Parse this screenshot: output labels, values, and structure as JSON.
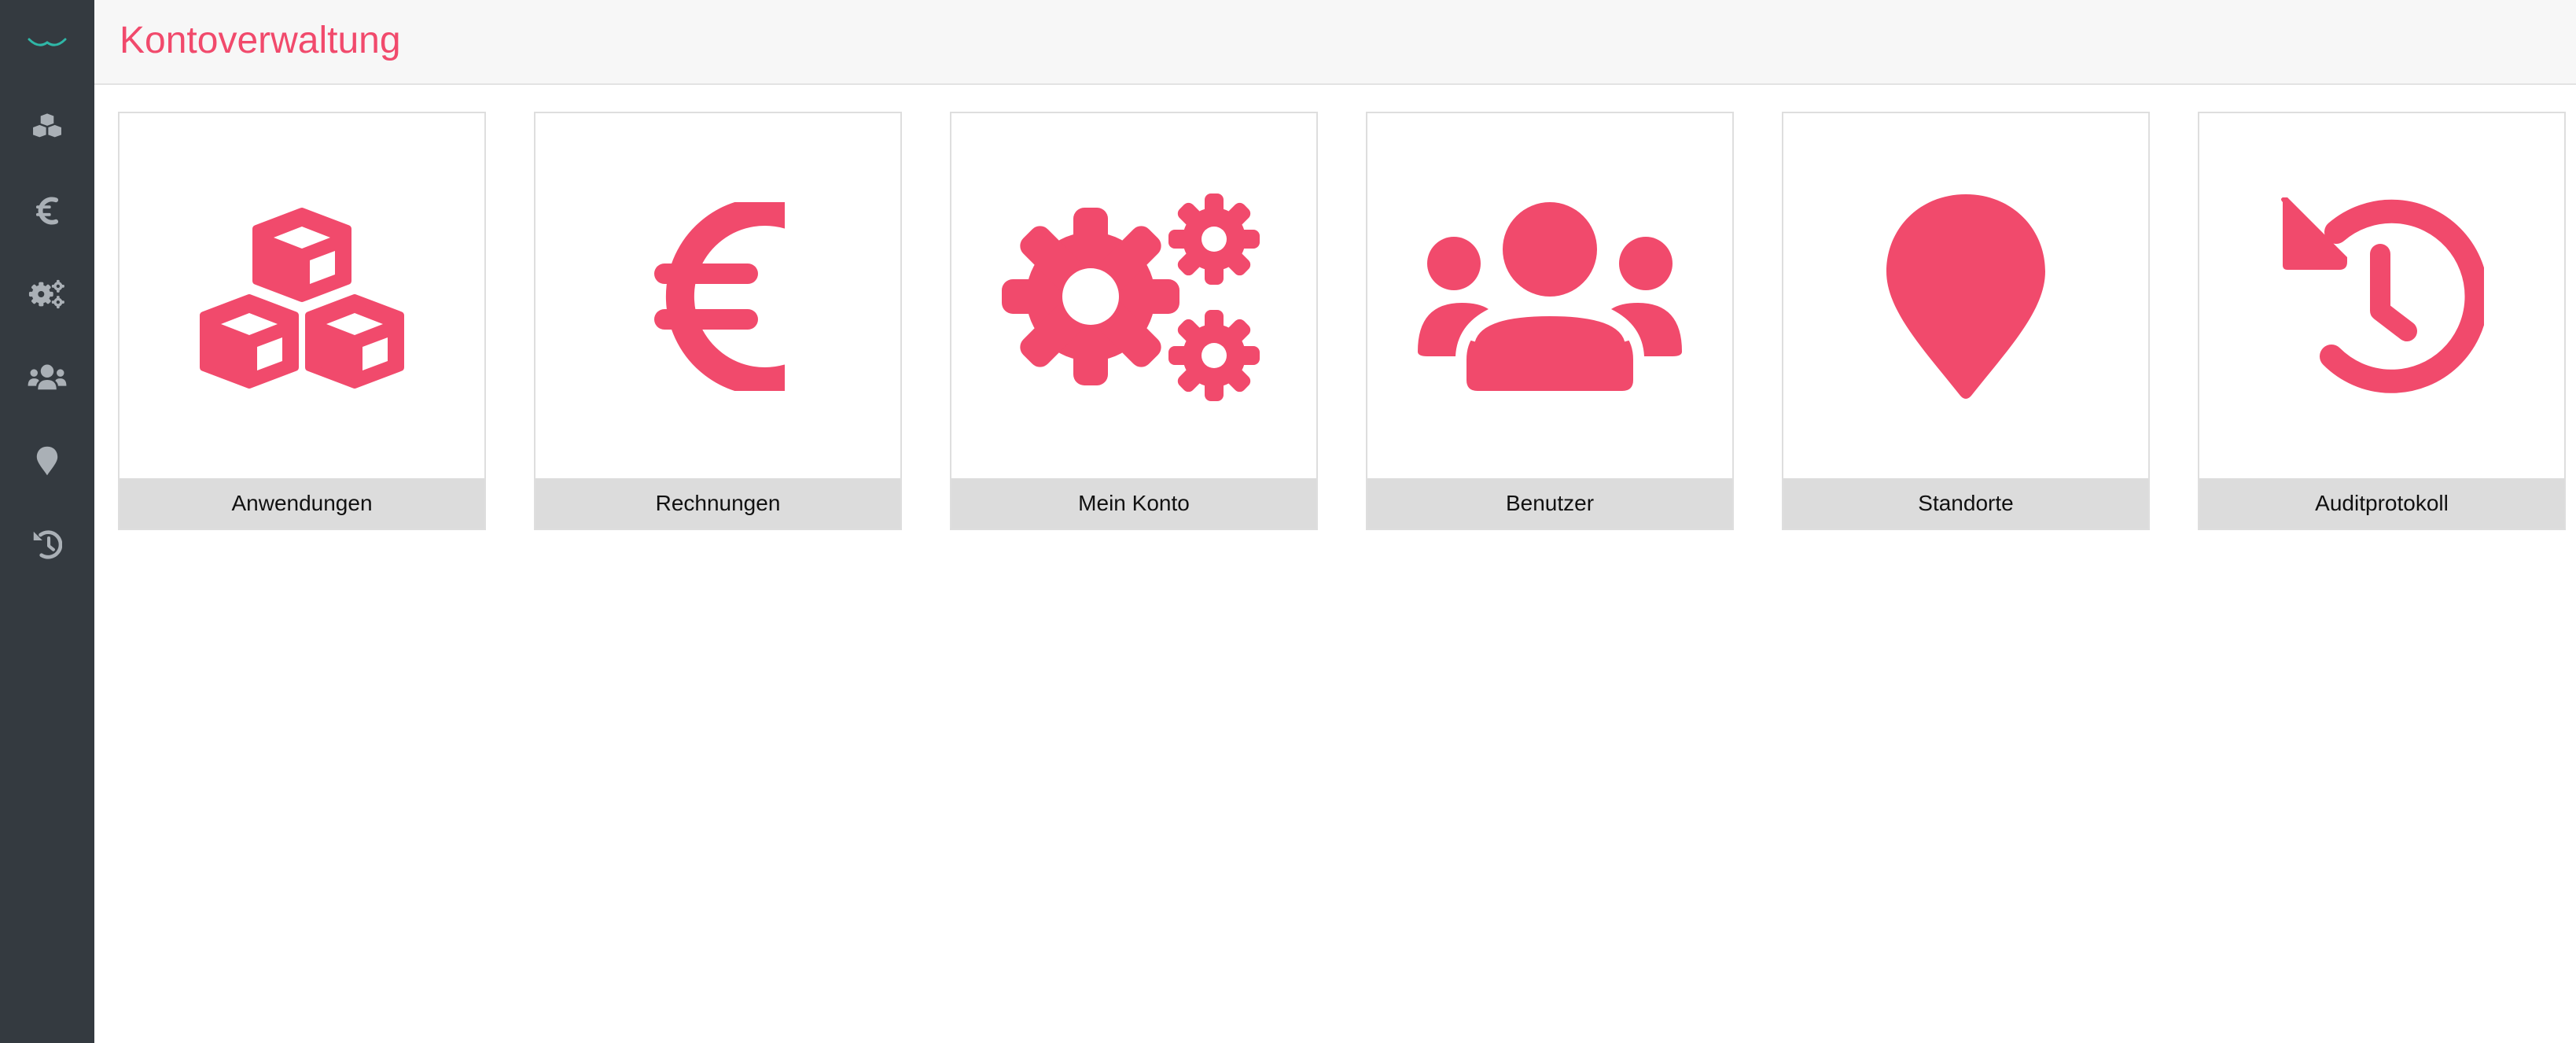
{
  "header": {
    "title": "Kontoverwaltung"
  },
  "colors": {
    "accent": "#f14a6c",
    "sidebar_bg": "#343a40",
    "sidebar_icon": "#aab0b6",
    "logo": "#2fb7a7",
    "tile_label_bg": "#dcdcdc"
  },
  "sidebar": {
    "items": [
      {
        "icon": "cubes-icon"
      },
      {
        "icon": "euro-icon"
      },
      {
        "icon": "gears-icon"
      },
      {
        "icon": "users-icon"
      },
      {
        "icon": "map-marker-icon"
      },
      {
        "icon": "history-icon"
      }
    ]
  },
  "tiles": [
    {
      "label": "Anwendungen",
      "icon": "cubes-icon"
    },
    {
      "label": "Rechnungen",
      "icon": "euro-icon"
    },
    {
      "label": "Mein Konto",
      "icon": "gears-icon"
    },
    {
      "label": "Benutzer",
      "icon": "users-icon"
    },
    {
      "label": "Standorte",
      "icon": "map-marker-icon"
    },
    {
      "label": "Auditprotokoll",
      "icon": "history-icon"
    }
  ]
}
